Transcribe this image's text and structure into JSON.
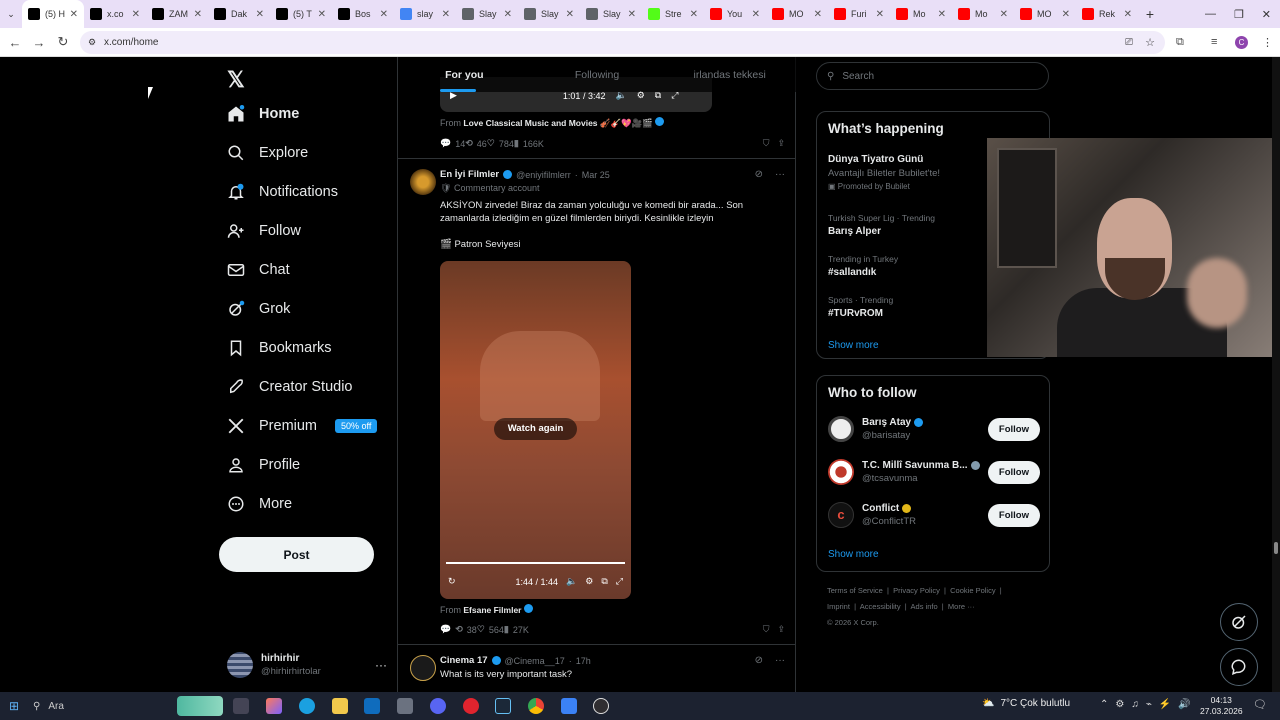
{
  "browser": {
    "tabs": [
      {
        "title": "(5) H",
        "icon": "x-icon",
        "color": "#000"
      },
      {
        "title": "x.co",
        "icon": "x-icon",
        "color": "#000"
      },
      {
        "title": "ZAM",
        "icon": "x-icon",
        "color": "#000"
      },
      {
        "title": "Dak",
        "icon": "x-icon",
        "color": "#000"
      },
      {
        "title": "(5) T",
        "icon": "x-icon",
        "color": "#000"
      },
      {
        "title": "Bos",
        "icon": "grok-icon",
        "color": "#000"
      },
      {
        "title": "slay",
        "icon": "google-icon",
        "color": "#4285f4"
      },
      {
        "title": "Slay",
        "icon": "globe-icon",
        "color": "#5f6368"
      },
      {
        "title": "Slay",
        "icon": "globe-icon",
        "color": "#5f6368"
      },
      {
        "title": "Slay",
        "icon": "globe-icon",
        "color": "#5f6368"
      },
      {
        "title": "Stre",
        "icon": "kick-icon",
        "color": "#53fc18"
      },
      {
        "title": "You",
        "icon": "youtube-icon",
        "color": "#ff0000"
      },
      {
        "title": "MO",
        "icon": "youtube-icon",
        "color": "#ff0000"
      },
      {
        "title": "Furi",
        "icon": "youtube-icon",
        "color": "#ff0000"
      },
      {
        "title": "Mo",
        "icon": "youtube-icon",
        "color": "#ff0000"
      },
      {
        "title": "Mo",
        "icon": "youtube-icon",
        "color": "#ff0000"
      },
      {
        "title": "MO",
        "icon": "youtube-icon",
        "color": "#ff0000"
      },
      {
        "title": "Rek",
        "icon": "youtube-icon",
        "color": "#ff0000"
      }
    ],
    "url": "x.com/home",
    "new_tab": "+",
    "profile_initial": "C"
  },
  "nav": {
    "home": "Home",
    "explore": "Explore",
    "notifications": "Notifications",
    "follow": "Follow",
    "chat": "Chat",
    "grok": "Grok",
    "bookmarks": "Bookmarks",
    "creator_studio": "Creator Studio",
    "premium": "Premium",
    "premium_badge": "50% off",
    "profile": "Profile",
    "more": "More",
    "post": "Post",
    "account_name": "hirhirhir",
    "account_handle": "@hirhirhirtolar"
  },
  "feed": {
    "tabs": [
      "For you",
      "Following",
      "irlandas tekkesi"
    ],
    "video1": {
      "time": "1:01 / 3:42",
      "from_prefix": "From",
      "from": "Love Classical Music and Movies 🎻🎸💖🎥🎬"
    },
    "post1_actions": {
      "replies": "14",
      "reposts": "46",
      "likes": "784",
      "views": "166K"
    },
    "post2": {
      "name": "En İyi Filmler",
      "handle": "@eniyifilmlerr",
      "date": "Mar 25",
      "commentary": "Commentary account",
      "text": "AKSİYON zirvede! Biraz da zaman yolculuğu ve komedi bir arada... Son zamanlarda izlediğim en güzel filmlerden biriydi. Kesinlikle izleyin",
      "subtext": "🎬 Patron Seviyesi",
      "watch_again": "Watch again",
      "video_time": "1:44 / 1:44",
      "from_prefix": "From",
      "from": "Efsane Filmler",
      "replies": "",
      "reposts": "38",
      "likes": "564",
      "views": "27K"
    },
    "post3": {
      "name": "Cinema 17",
      "handle": "@Cinema__17",
      "date": "17h",
      "text": "What is its very important task?"
    }
  },
  "right": {
    "search_placeholder": "Search",
    "happening_title": "What’s happening",
    "promo": {
      "title": "Dünya Tiyatro Günü",
      "sub": "Avantajlı Biletler Bubilet'te!",
      "promoted": "Promoted by Bubilet"
    },
    "trends": [
      {
        "context": "Turkish Super Lig · Trending",
        "name": "Barış Alper"
      },
      {
        "context": "Trending in Turkey",
        "name": "#sallandık"
      },
      {
        "context": "Sports · Trending",
        "name": "#TURvROM"
      }
    ],
    "show_more": "Show more",
    "wtf_title": "Who to follow",
    "who_to_follow": [
      {
        "name": "Barış Atay",
        "handle": "@barisatay",
        "button": "Follow",
        "verified": "#1d9bf0"
      },
      {
        "name": "T.C. Millî Savunma B...",
        "handle": "@tcsavunma",
        "button": "Follow",
        "verified": "#829aab"
      },
      {
        "name": "Conflict",
        "handle": "@ConflictTR",
        "button": "Follow",
        "verified": "#e2b719"
      }
    ],
    "wtf_show_more": "Show more",
    "footer": [
      "Terms of Service",
      "Privacy Policy",
      "Cookie Policy",
      "Imprint",
      "Accessibility",
      "Ads info",
      "More ···",
      "© 2026 X Corp."
    ]
  },
  "taskbar": {
    "search": "Ara",
    "weather": "7°C Çok bulutlu",
    "time": "04:13",
    "date": "27.03.2026"
  }
}
